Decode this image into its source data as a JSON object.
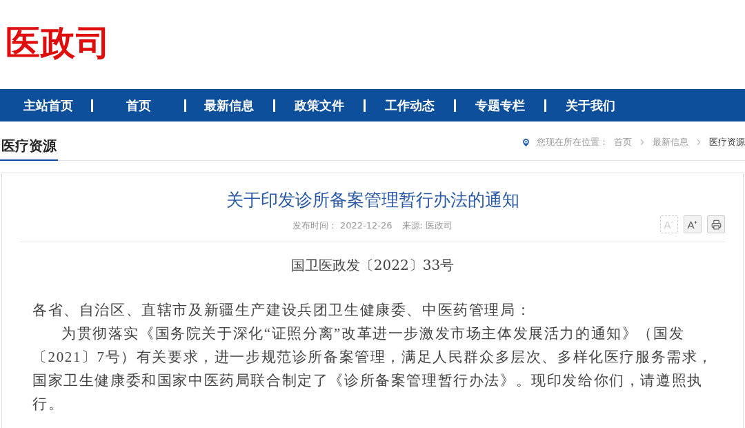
{
  "logo": {
    "text": "医政司"
  },
  "nav": {
    "items": [
      {
        "label": "主站首页"
      },
      {
        "label": "首页"
      },
      {
        "label": "最新信息"
      },
      {
        "label": "政策文件"
      },
      {
        "label": "工作动态"
      },
      {
        "label": "专题专栏"
      },
      {
        "label": "关于我们"
      }
    ]
  },
  "section": {
    "title": "医疗资源"
  },
  "breadcrumb": {
    "prefix": "您现在所在位置：",
    "items": [
      {
        "label": "首页",
        "current": false
      },
      {
        "label": "最新信息",
        "current": false
      },
      {
        "label": "医疗资源",
        "current": true
      }
    ]
  },
  "article": {
    "title": "关于印发诊所备案管理暂行办法的通知",
    "meta": [
      {
        "label": "发布时间：",
        "value": "2022-12-26"
      },
      {
        "label": "来源:",
        "value": "医政司"
      }
    ],
    "font_buttons": [
      {
        "label": "A⁻",
        "disabled": true
      },
      {
        "label": "A⁺",
        "disabled": false
      }
    ],
    "doc_number": "国卫医政发〔2022〕33号",
    "paragraphs": [
      {
        "kind": "salutation",
        "text": "各省、自治区、直辖市及新疆生产建设兵团卫生健康委、中医药管理局："
      },
      {
        "kind": "body",
        "text": "为贯彻落实《国务院关于深化“证照分离”改革进一步激发市场主体发展活力的通知》（国发〔2021〕7号）有关要求，进一步规范诊所备案管理，满足人民群众多层次、多样化医疗服务需求，国家卫生健康委和国家中医药局联合制定了《诊所备案管理暂行办法》。现印发给你们，请遵照执行。"
      }
    ]
  }
}
